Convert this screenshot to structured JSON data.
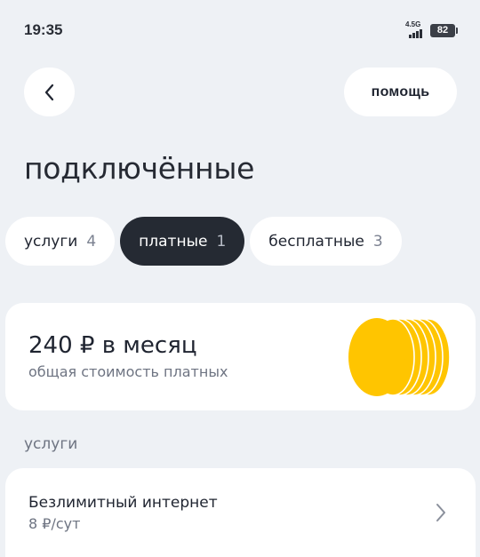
{
  "status_bar": {
    "time": "19:35",
    "network": "4.5G",
    "battery": "82"
  },
  "header": {
    "help_label": "помощь"
  },
  "page_title": "подключённые",
  "tabs": [
    {
      "label": "услуги",
      "count": "4",
      "active": false
    },
    {
      "label": "платные",
      "count": "1",
      "active": true
    },
    {
      "label": "бесплатные",
      "count": "3",
      "active": false
    }
  ],
  "summary": {
    "price": "240 ₽ в месяц",
    "caption": "общая стоимость платных",
    "coin_color": "#ffc500"
  },
  "section_label": "услуги",
  "services": [
    {
      "name": "Безлимитный интернет",
      "price": "8 ₽/сут"
    }
  ],
  "colors": {
    "background": "#eef1f5",
    "card": "#ffffff",
    "active_chip": "#252a33",
    "muted_text": "#6e7482"
  }
}
